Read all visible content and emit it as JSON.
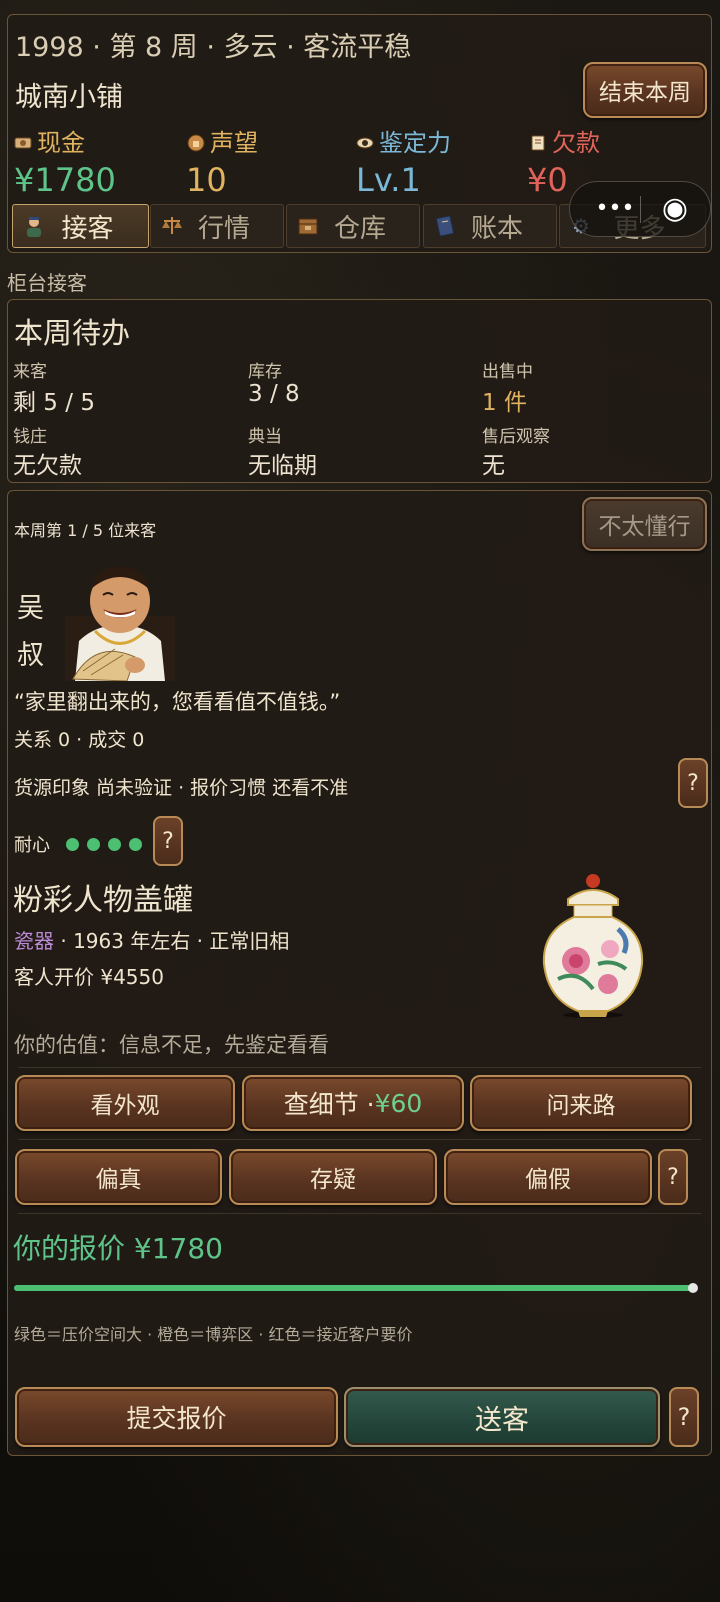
{
  "header": {
    "status_line": "1998 · 第 8 周 · 多云 · 客流平稳",
    "shop_name": "城南小铺",
    "end_week_button": "结束本周"
  },
  "stats": [
    {
      "label": "现金",
      "value": "¥1780",
      "icon": "cash-icon",
      "color": "#5ec48a"
    },
    {
      "label": "声望",
      "value": "10",
      "icon": "thumbs-up-icon",
      "color": "#e0b360"
    },
    {
      "label": "鉴定力",
      "value": "Lv.1",
      "icon": "eye-icon",
      "color": "#7bb7d6"
    },
    {
      "label": "欠款",
      "value": "¥0",
      "icon": "scroll-icon",
      "color": "#e1645a"
    }
  ],
  "tabs": [
    {
      "label": "接客",
      "icon": "clerk-icon"
    },
    {
      "label": "行情",
      "icon": "scale-icon"
    },
    {
      "label": "仓库",
      "icon": "crate-icon"
    },
    {
      "label": "账本",
      "icon": "ledger-icon"
    },
    {
      "label": "更多",
      "icon": "gear-icon"
    }
  ],
  "section_title": "柜台接客",
  "todo": {
    "title": "本周待办",
    "items": [
      {
        "label": "来客",
        "value": "剩 5 / 5"
      },
      {
        "label": "库存",
        "value": "3 / 8"
      },
      {
        "label": "出售中",
        "value": "1 件",
        "highlight": "#e0b360"
      },
      {
        "label": "钱庄",
        "value": "无欠款"
      },
      {
        "label": "典当",
        "value": "无临期"
      },
      {
        "label": "售后观察",
        "value": "无"
      }
    ]
  },
  "customer": {
    "counter": "本周第 1 / 5 位来客",
    "confused_button": "不太懂行",
    "name_char1": "吴",
    "name_char2": "叔",
    "quote": "“家里翻出来的，您看看值不值钱。”",
    "relation": "关系 0 · 成交 0",
    "impression": "货源印象 尚未验证 · 报价习惯 还看不准",
    "patience_label": "耐心",
    "patience": 4
  },
  "item": {
    "name": "粉彩人物盖罐",
    "category": "瓷器",
    "meta": " · 1963 年左右 · 正常旧相",
    "asking_price": "客人开价 ¥4550",
    "estimate": "你的估值：信息不足，先鉴定看看"
  },
  "inspect_buttons": {
    "look": "看外观",
    "detail": "查细节 · ",
    "detail_cost": "¥60",
    "origin": "问来路"
  },
  "verdict_buttons": {
    "real": "偏真",
    "doubt": "存疑",
    "fake": "偏假"
  },
  "offer": {
    "label": "你的报价 ¥1780",
    "slider_fraction": 1.0,
    "legend": "绿色＝压价空间大 · 橙色＝博弈区 · 红色＝接近客户要价"
  },
  "actions": {
    "submit": "提交报价",
    "send_off": "送客"
  },
  "help_glyph": "?",
  "mini_program": {
    "menu_glyph": "•••",
    "close_glyph": "◉"
  }
}
